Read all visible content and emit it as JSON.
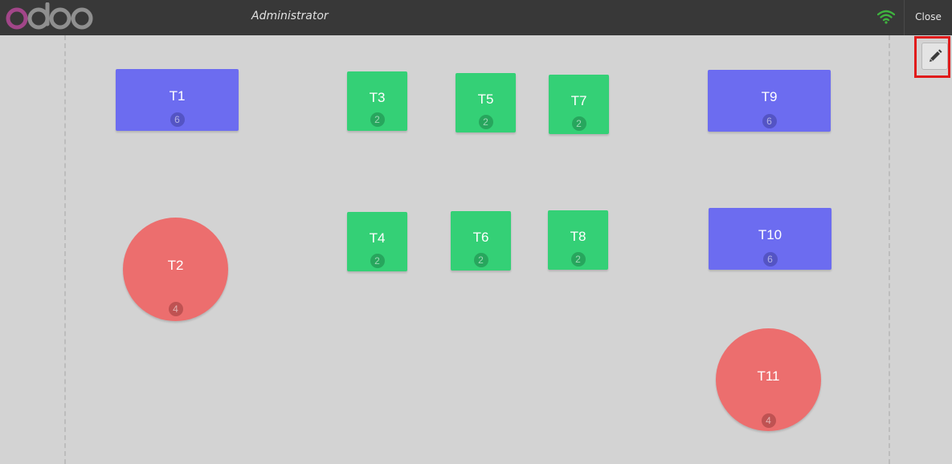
{
  "header": {
    "logo_text": "odoo",
    "user_name": "Administrator",
    "close_label": "Close",
    "connection_icon": "wifi-icon",
    "connection_color": "#3fb33f"
  },
  "floor": {
    "edit_icon": "pencil-icon",
    "tables": [
      {
        "name": "T1",
        "seats": "6",
        "shape": "square",
        "color": "#6c6cf0"
      },
      {
        "name": "T2",
        "seats": "4",
        "shape": "round",
        "color": "#ec6e6e"
      },
      {
        "name": "T3",
        "seats": "2",
        "shape": "square",
        "color": "#34d076"
      },
      {
        "name": "T4",
        "seats": "2",
        "shape": "square",
        "color": "#34d076"
      },
      {
        "name": "T5",
        "seats": "2",
        "shape": "square",
        "color": "#34d076"
      },
      {
        "name": "T6",
        "seats": "2",
        "shape": "square",
        "color": "#34d076"
      },
      {
        "name": "T7",
        "seats": "2",
        "shape": "square",
        "color": "#34d076"
      },
      {
        "name": "T8",
        "seats": "2",
        "shape": "square",
        "color": "#34d076"
      },
      {
        "name": "T9",
        "seats": "6",
        "shape": "square",
        "color": "#6c6cf0"
      },
      {
        "name": "T10",
        "seats": "6",
        "shape": "square",
        "color": "#6c6cf0"
      },
      {
        "name": "T11",
        "seats": "4",
        "shape": "round",
        "color": "#ec6e6e"
      }
    ]
  }
}
